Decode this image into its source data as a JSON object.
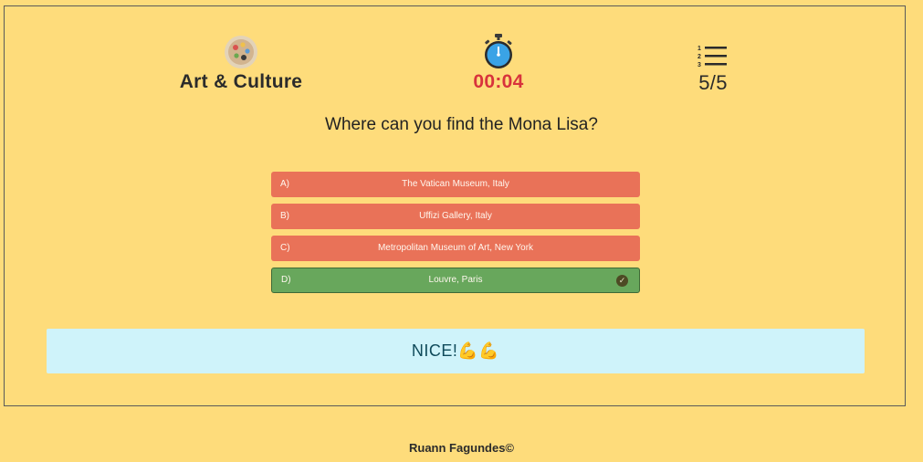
{
  "header": {
    "category": {
      "icon": "palette-icon",
      "label": "Art & Culture"
    },
    "timer": {
      "icon": "stopwatch-icon",
      "value": "00:04",
      "color": "#d8333c"
    },
    "progress": {
      "icon": "numbered-list-icon",
      "value": "5/5"
    }
  },
  "question": "Where can you find the Mona Lisa?",
  "answers": [
    {
      "letter": "A)",
      "text": "The Vatican Museum, Italy",
      "state": "wrong"
    },
    {
      "letter": "B)",
      "text": "Uffizi Gallery, Italy",
      "state": "wrong"
    },
    {
      "letter": "C)",
      "text": "Metropolitan Museum of Art, New York",
      "state": "wrong"
    },
    {
      "letter": "D)",
      "text": "Louvre, Paris",
      "state": "correct",
      "check_icon": "check-circle-icon"
    }
  ],
  "feedback": {
    "text": "NICE!",
    "emoji": "💪💪"
  },
  "footer": "Ruann Fagundes©",
  "colors": {
    "background": "#fedc7b",
    "wrong": "#e97258",
    "correct": "#68a75c",
    "feedback_bg": "#cff3fa"
  }
}
